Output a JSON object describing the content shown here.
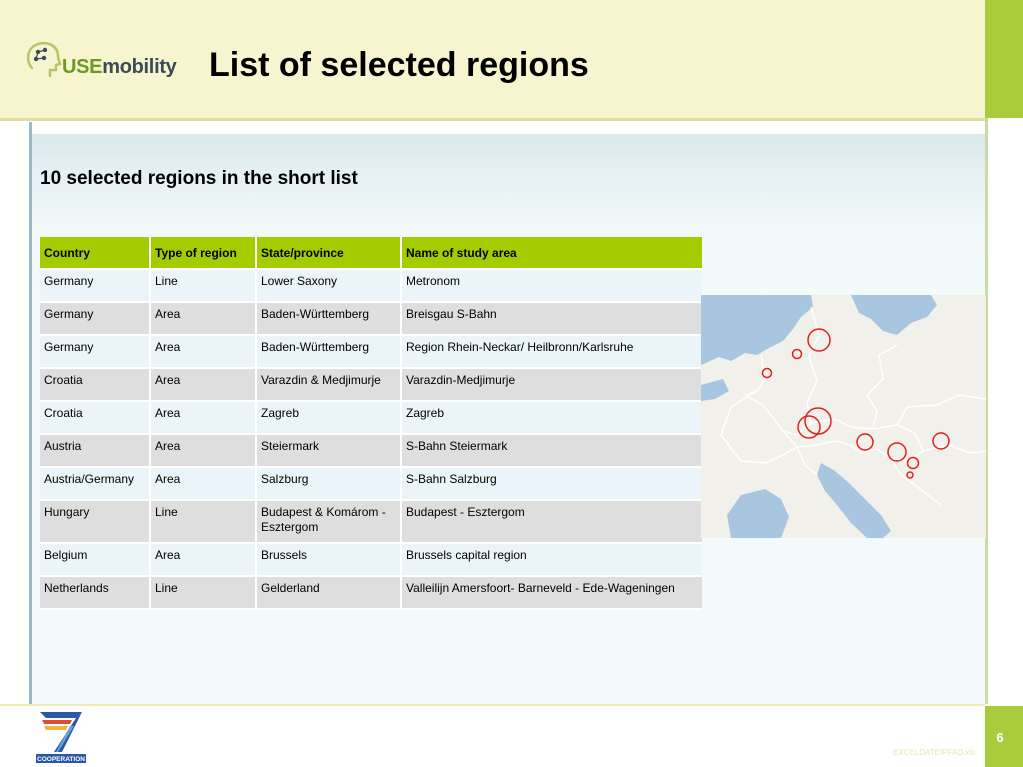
{
  "header": {
    "logo_prefix": "USE",
    "logo_suffix": "mobility",
    "title": "List of selected regions"
  },
  "subtitle": "10 selected regions in the short list",
  "table": {
    "columns": [
      "Country",
      "Type of region",
      "State/province",
      "Name of study area"
    ],
    "rows": [
      [
        "Germany",
        "Line",
        "Lower Saxony",
        "Metronom"
      ],
      [
        "Germany",
        "Area",
        "Baden-Württemberg",
        "Breisgau S-Bahn"
      ],
      [
        "Germany",
        "Area",
        "Baden-Württemberg",
        "Region Rhein-Neckar/ Heilbronn/Karlsruhe"
      ],
      [
        "Croatia",
        "Area",
        "Varazdin & Medjimurje",
        "Varazdin-Medjimurje"
      ],
      [
        "Croatia",
        "Area",
        "Zagreb",
        "Zagreb"
      ],
      [
        "Austria",
        "Area",
        "Steiermark",
        "S-Bahn Steiermark"
      ],
      [
        "Austria/Germany",
        "Area",
        "Salzburg",
        "S-Bahn Salzburg"
      ],
      [
        "Hungary",
        "Line",
        "Budapest & Komárom - Esztergom",
        "Budapest - Esztergom"
      ],
      [
        "Belgium",
        "Area",
        "Brussels",
        "Brussels capital region"
      ],
      [
        "Netherlands",
        "Line",
        "Gelderland",
        "Valleilijn Amersfoort- Barneveld - Ede-Wageningen"
      ]
    ]
  },
  "map": {
    "marker_color": "#e02020",
    "marker_count": 10
  },
  "footer": {
    "programme_label": "COOPERATION",
    "page_number": "6",
    "watermark": "EXCELDATEIPFAD.xls"
  },
  "colors": {
    "header_bg": "#f7f5cf",
    "accent_green": "#a8cc3c",
    "table_header": "#a3cd00"
  }
}
